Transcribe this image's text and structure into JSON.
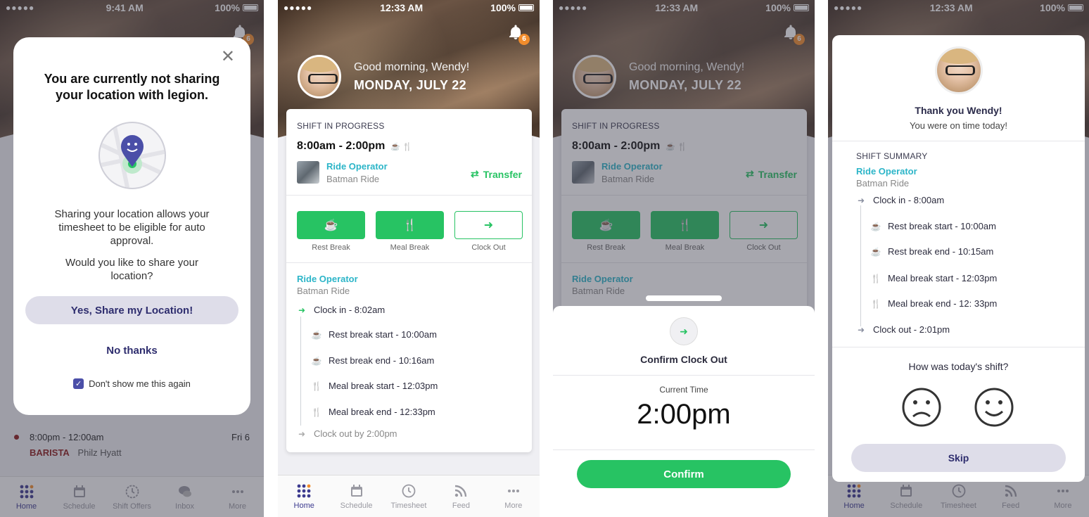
{
  "statusbar": [
    {
      "time": "9:41 AM",
      "battery": "100%"
    },
    {
      "time": "12:33 AM",
      "battery": "100%"
    },
    {
      "time": "12:33 AM",
      "battery": "100%"
    },
    {
      "time": "12:33 AM",
      "battery": "100%"
    }
  ],
  "bell_count": "6",
  "greeting": {
    "hello": "Good morning, Wendy!",
    "date": "MONDAY, JULY 22"
  },
  "screen1": {
    "modal": {
      "title": "You are currently not sharing your location with legion.",
      "body1": "Sharing your location allows your timesheet to be eligible for auto approval.",
      "body2": "Would you like to share your location?",
      "primary": "Yes, Share my Location!",
      "secondary": "No thanks",
      "checkbox_label": "Don't show me this again"
    },
    "bg_shift": {
      "time": "8:00pm - 12:00am",
      "day": "Fri 6",
      "role": "BARISTA",
      "location": "Philz Hyatt"
    },
    "tabs": [
      "Home",
      "Schedule",
      "Shift Offers",
      "Inbox",
      "More"
    ]
  },
  "shift": {
    "status": "SHIFT IN PROGRESS",
    "time": "8:00am - 2:00pm",
    "role": "Ride Operator",
    "location": "Batman Ride",
    "transfer": "Transfer",
    "actions": [
      "Rest Break",
      "Meal Break",
      "Clock Out"
    ]
  },
  "screen2": {
    "role": "Ride Operator",
    "location": "Batman Ride",
    "timeline": [
      "Clock in - 8:02am",
      "Rest break start - 10:00am",
      "Rest break end - 10:16am",
      "Meal break start - 12:03pm",
      "Meal break end - 12:33pm",
      "Clock out by 2:00pm"
    ],
    "tabs": [
      "Home",
      "Schedule",
      "Timesheet",
      "Feed",
      "More"
    ]
  },
  "screen3": {
    "confirm_title": "Confirm Clock Out",
    "current_time_label": "Current Time",
    "current_time": "2:00pm",
    "confirm_button": "Confirm"
  },
  "screen4": {
    "thanks": "Thank you Wendy!",
    "ontime": "You were on time today!",
    "summary_label": "SHIFT SUMMARY",
    "role": "Ride Operator",
    "location": "Batman Ride",
    "timeline": [
      "Clock in - 8:00am",
      "Rest break start - 10:00am",
      "Rest break end - 10:15am",
      "Meal break start - 12:03pm",
      "Meal break end - 12: 33pm",
      "Clock out - 2:01pm"
    ],
    "question": "How was today's shift?",
    "skip": "Skip",
    "tabs": [
      "Home",
      "Schedule",
      "Timesheet",
      "Feed",
      "More"
    ]
  },
  "colors": {
    "green": "#27c363",
    "teal": "#2cb5c8",
    "indigo": "#3c3a8f",
    "orange": "#f08c2c"
  }
}
